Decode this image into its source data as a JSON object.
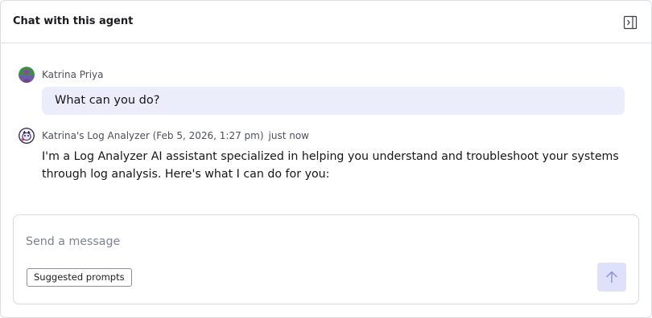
{
  "header": {
    "title": "Chat with this agent",
    "collapse_icon": "panel-collapse-icon"
  },
  "messages": [
    {
      "role": "user",
      "author": "Katrina Priya",
      "avatar_icon": "user-avatar-icon",
      "text": "What can you do?"
    },
    {
      "role": "agent",
      "author": "Katrina's Log Analyzer (Feb 5, 2026, 1:27 pm)",
      "timestamp": "just now",
      "avatar_icon": "agent-avatar-icon",
      "text": "I'm a Log Analyzer AI assistant specialized in helping you understand and troubleshoot your systems through log analysis. Here's what I can do for you:"
    }
  ],
  "composer": {
    "placeholder": "Send a message",
    "value": "",
    "suggested_prompts_label": "Suggested prompts",
    "send_icon": "arrow-up-icon"
  },
  "colors": {
    "user_bubble": "#ecedfb",
    "send_button": "#dfe1fb",
    "send_arrow": "#8b90d6",
    "border": "#dcdde3"
  }
}
